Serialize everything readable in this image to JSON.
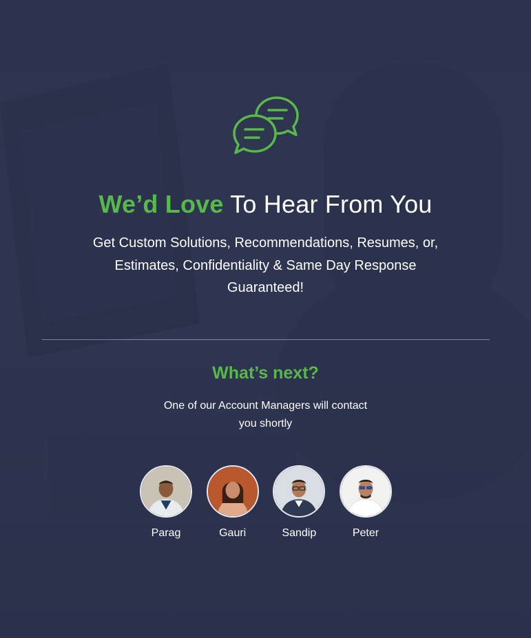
{
  "icon": "chat-bubbles-icon",
  "colors": {
    "accent": "#58b94a",
    "background": "#2f3650",
    "text": "#ffffff"
  },
  "heading": {
    "accent": "We’d Love",
    "rest": " To Hear From You"
  },
  "subtitle": "Get Custom Solutions, Recommendations, Resumes,  or, Estimates, Confidentiality & Same Day Response Guaranteed!",
  "next": {
    "title": "What’s next?",
    "text": "One of our Account Managers will contact you shortly"
  },
  "managers": [
    {
      "name": "Parag"
    },
    {
      "name": "Gauri"
    },
    {
      "name": "Sandip"
    },
    {
      "name": "Peter"
    }
  ]
}
